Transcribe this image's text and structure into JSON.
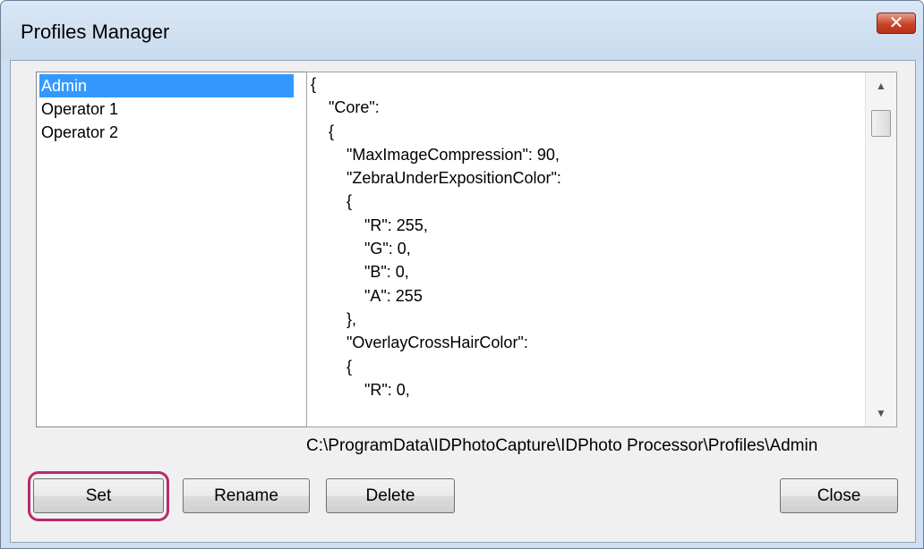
{
  "window": {
    "title": "Profiles Manager",
    "close_glyph": "✕"
  },
  "profiles": {
    "items": [
      {
        "label": "Admin",
        "selected": true
      },
      {
        "label": "Operator 1",
        "selected": false
      },
      {
        "label": "Operator 2",
        "selected": false
      }
    ]
  },
  "editor": {
    "content": "{\n    \"Core\":\n    {\n        \"MaxImageCompression\": 90,\n        \"ZebraUnderExpositionColor\":\n        {\n            \"R\": 255,\n            \"G\": 0,\n            \"B\": 0,\n            \"A\": 255\n        },\n        \"OverlayCrossHairColor\":\n        {\n            \"R\": 0,",
    "scroll_up_glyph": "▲",
    "scroll_down_glyph": "▼"
  },
  "path": "C:\\ProgramData\\IDPhotoCapture\\IDPhoto Processor\\Profiles\\Admin",
  "buttons": {
    "set": "Set",
    "rename": "Rename",
    "delete": "Delete",
    "close": "Close"
  },
  "colors": {
    "selection": "#3399ff",
    "highlight_ring": "#b82a6e",
    "close_button": "#c8432a"
  }
}
